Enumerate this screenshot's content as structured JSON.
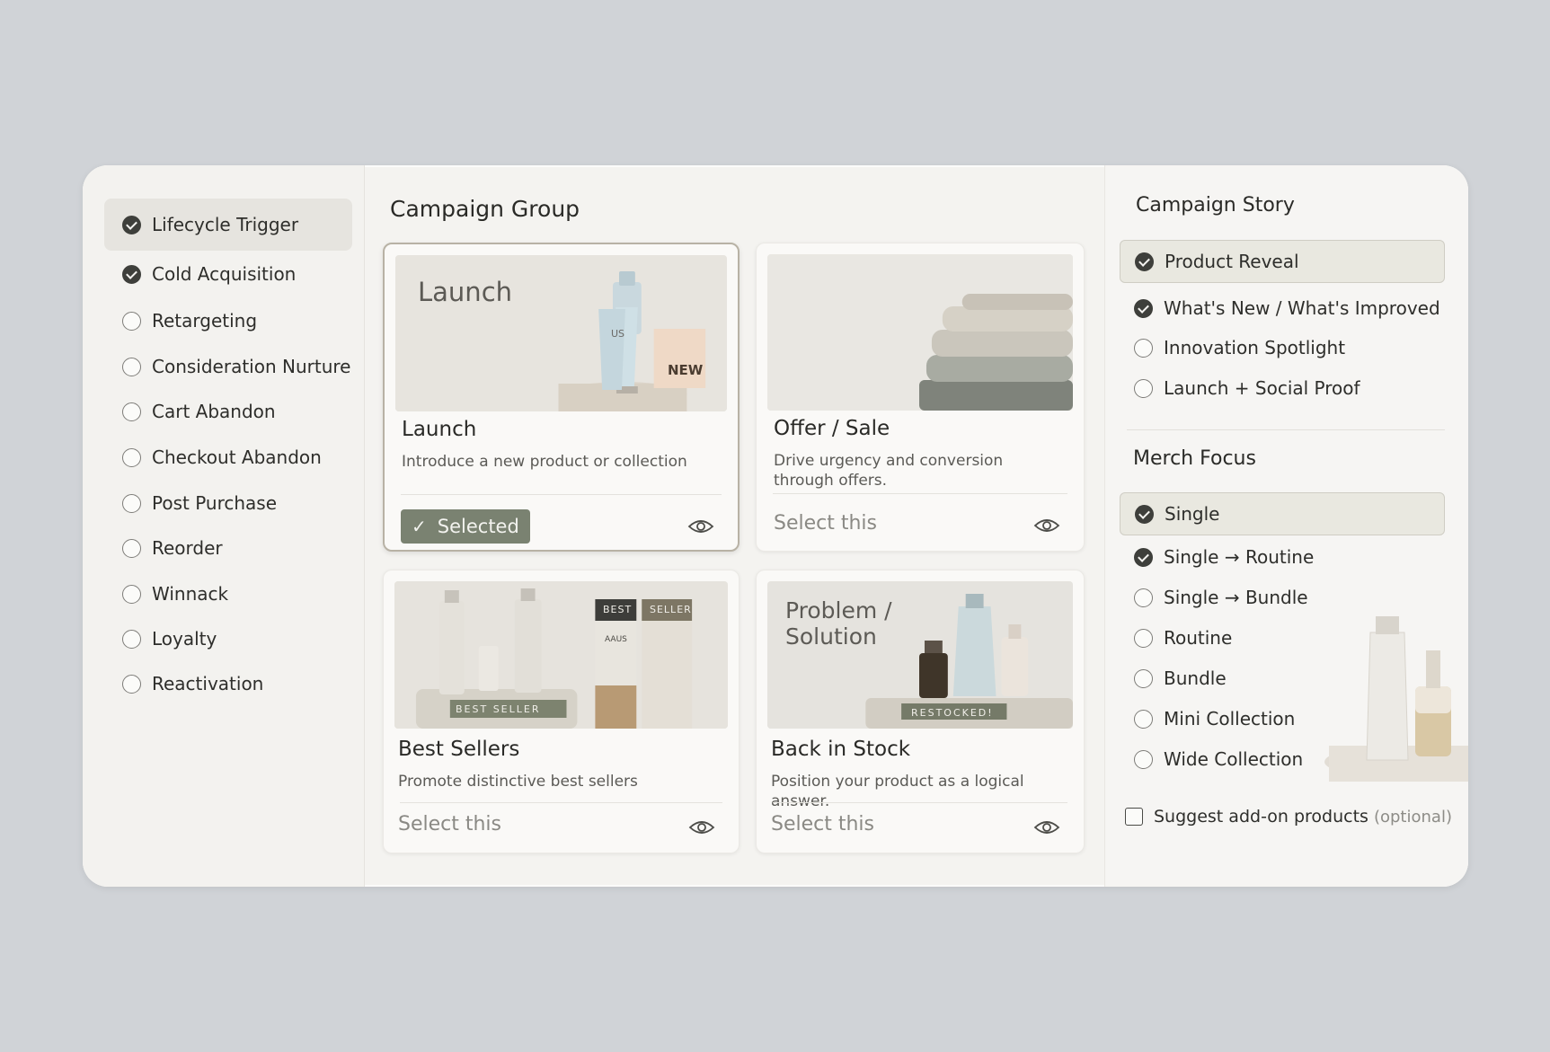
{
  "sidebar": {
    "items": [
      {
        "label": "Lifecycle Trigger",
        "checked": true,
        "active": true
      },
      {
        "label": "Cold Acquisition",
        "checked": true,
        "active": false
      },
      {
        "label": "Retargeting",
        "checked": false,
        "active": false
      },
      {
        "label": "Consideration Nurture",
        "checked": false,
        "active": false
      },
      {
        "label": "Cart Abandon",
        "checked": false,
        "active": false
      },
      {
        "label": "Checkout Abandon",
        "checked": false,
        "active": false
      },
      {
        "label": "Post Purchase",
        "checked": false,
        "active": false
      },
      {
        "label": "Reorder",
        "checked": false,
        "active": false
      },
      {
        "label": "Winnack",
        "checked": false,
        "active": false
      },
      {
        "label": "Loyalty",
        "checked": false,
        "active": false
      },
      {
        "label": "Reactivation",
        "checked": false,
        "active": false
      }
    ]
  },
  "campaign_group": {
    "title": "Campaign Group",
    "cards": [
      {
        "name": "Launch",
        "description": "Introduce a new product or collection",
        "image_title": "Launch",
        "image_tags": [
          "US",
          "NEW"
        ],
        "selected": true,
        "action": "Selected"
      },
      {
        "name": "Offer / Sale",
        "description": "Drive urgency and conversion through offers.",
        "selected": false,
        "action": "Select this"
      },
      {
        "name": "Best Sellers",
        "description": "Promote distinctive best sellers",
        "image_tags": [
          "BEST",
          "SELLER",
          "BEST SELLER",
          "AAUS"
        ],
        "selected": false,
        "action": "Select this"
      },
      {
        "name": "Back in Stock",
        "description": "Position your product as a logical answer.",
        "image_title": "Problem / Solution",
        "image_tags": [
          "RESTOCKED!"
        ],
        "selected": false,
        "action": "Select this"
      }
    ]
  },
  "campaign_story": {
    "title": "Campaign Story",
    "options": [
      {
        "label": "Product Reveal",
        "checked": true,
        "active": true
      },
      {
        "label": "What's New / What's Improved",
        "checked": true,
        "active": false
      },
      {
        "label": "Innovation Spotlight",
        "checked": false,
        "active": false
      },
      {
        "label": "Launch + Social Proof",
        "checked": false,
        "active": false
      }
    ]
  },
  "merch_focus": {
    "title": "Merch Focus",
    "options": [
      {
        "label": "Single",
        "checked": true,
        "active": true
      },
      {
        "label": "Single → Routine",
        "checked": true,
        "active": false
      },
      {
        "label": "Single → Bundle",
        "checked": false,
        "active": false
      },
      {
        "label": "Routine",
        "checked": false,
        "active": false
      },
      {
        "label": "Bundle",
        "checked": false,
        "active": false
      },
      {
        "label": "Mini Collection",
        "checked": false,
        "active": false
      },
      {
        "label": "Wide Collection",
        "checked": false,
        "active": false
      }
    ]
  },
  "addons": {
    "label": "Suggest add-on products",
    "optional": "(optional)",
    "checked": false
  },
  "colors": {
    "accent": "#7a8271",
    "background": "#d0d3d7",
    "panel": "#f4f3f0"
  }
}
